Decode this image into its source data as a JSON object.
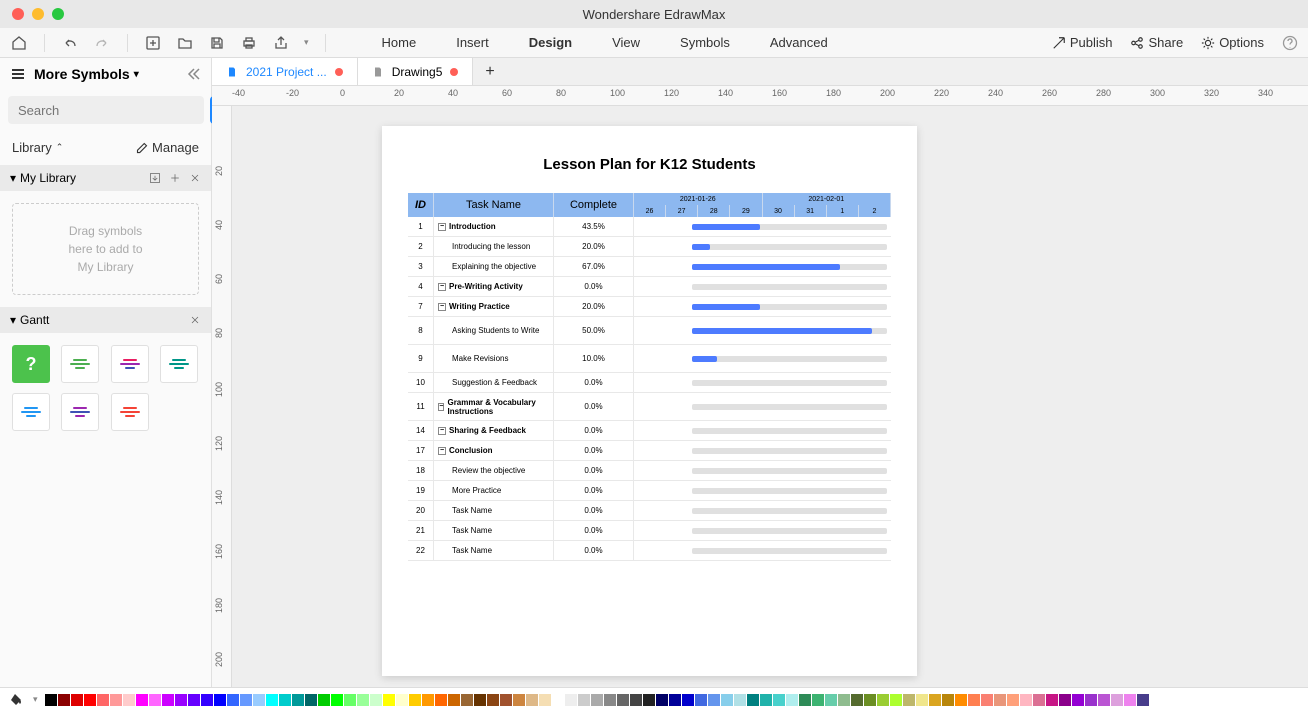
{
  "app_title": "Wondershare EdrawMax",
  "menu": [
    "Home",
    "Insert",
    "Design",
    "View",
    "Symbols",
    "Advanced"
  ],
  "menu_active": "Design",
  "right_actions": {
    "publish": "Publish",
    "share": "Share",
    "options": "Options"
  },
  "tabs": [
    {
      "label": "2021 Project ...",
      "modified": true,
      "active": true
    },
    {
      "label": "Drawing5",
      "modified": true,
      "active": false
    }
  ],
  "sidebar": {
    "title": "More Symbols",
    "search_placeholder": "Search",
    "search_btn": "Search",
    "library_label": "Library",
    "manage_label": "Manage",
    "mylibrary_label": "My Library",
    "dropzone": "Drag symbols\nhere to add to\nMy Library",
    "gantt_label": "Gantt"
  },
  "ruler_h": [
    "-40",
    "-20",
    "0",
    "20",
    "40",
    "60",
    "80",
    "100",
    "120",
    "140",
    "160",
    "180",
    "200",
    "220",
    "240",
    "260",
    "280",
    "300",
    "320",
    "340"
  ],
  "ruler_v": [
    "20",
    "40",
    "60",
    "80",
    "100",
    "120",
    "140",
    "160",
    "180",
    "200"
  ],
  "page": {
    "title": "Lesson Plan for K12 Students",
    "headers": {
      "id": "ID",
      "name": "Task Name",
      "complete": "Complete"
    },
    "weeks": [
      "2021-01-26",
      "2021-02-01"
    ],
    "days": [
      "26",
      "27",
      "28",
      "29",
      "30",
      "31",
      "1",
      "2"
    ],
    "rows": [
      {
        "id": "1",
        "name": "Introduction",
        "complete": "43.5%",
        "bold": true,
        "expand": true,
        "fill": 38
      },
      {
        "id": "2",
        "name": "Introducing the lesson",
        "complete": "20.0%",
        "indent": true,
        "fill": 10
      },
      {
        "id": "3",
        "name": "Explaining the objective",
        "complete": "67.0%",
        "indent": true,
        "fill": 82
      },
      {
        "id": "4",
        "name": "Pre-Writing Activity",
        "complete": "0.0%",
        "bold": true,
        "expand": true,
        "fill": 0
      },
      {
        "id": "7",
        "name": "Writing Practice",
        "complete": "20.0%",
        "bold": true,
        "expand": true,
        "fill": 38
      },
      {
        "id": "8",
        "name": "Asking Students to Write",
        "complete": "50.0%",
        "indent": true,
        "fill": 100,
        "tall": true
      },
      {
        "id": "9",
        "name": "Make Revisions",
        "complete": "10.0%",
        "indent": true,
        "fill": 14,
        "tall": true
      },
      {
        "id": "10",
        "name": "Suggestion & Feedback",
        "complete": "0.0%",
        "indent": true,
        "fill": 0
      },
      {
        "id": "11",
        "name": "Grammar & Vocabulary Instructions",
        "complete": "0.0%",
        "bold": true,
        "expand": true,
        "fill": 0,
        "tall": true
      },
      {
        "id": "14",
        "name": "Sharing & Feedback",
        "complete": "0.0%",
        "bold": true,
        "expand": true,
        "fill": 0
      },
      {
        "id": "17",
        "name": "Conclusion",
        "complete": "0.0%",
        "bold": true,
        "expand": true,
        "fill": 0
      },
      {
        "id": "18",
        "name": "Review the objective",
        "complete": "0.0%",
        "indent": true,
        "fill": 0
      },
      {
        "id": "19",
        "name": "More Practice",
        "complete": "0.0%",
        "indent": true,
        "fill": 0
      },
      {
        "id": "20",
        "name": "Task Name",
        "complete": "0.0%",
        "indent": true,
        "fill": 0
      },
      {
        "id": "21",
        "name": "Task Name",
        "complete": "0.0%",
        "indent": true,
        "fill": 0
      },
      {
        "id": "22",
        "name": "Task Name",
        "complete": "0.0%",
        "indent": true,
        "fill": 0
      }
    ]
  },
  "colors": [
    "#000",
    "#8b0000",
    "#d00",
    "#f00",
    "#f66",
    "#f99",
    "#fcc",
    "#f0f",
    "#f6f",
    "#c0f",
    "#90f",
    "#60f",
    "#30f",
    "#00f",
    "#36f",
    "#69f",
    "#9cf",
    "#0ff",
    "#0cc",
    "#099",
    "#066",
    "#0c0",
    "#0f0",
    "#6f6",
    "#9f9",
    "#cfc",
    "#ff0",
    "#ffc",
    "#fc0",
    "#f90",
    "#f60",
    "#c60",
    "#963",
    "#630",
    "#8b4513",
    "#a0522d",
    "#cd853f",
    "#deb887",
    "#f5deb3",
    "#fff",
    "#eee",
    "#ccc",
    "#aaa",
    "#888",
    "#666",
    "#444",
    "#222",
    "#006",
    "#009",
    "#00c",
    "#4169e1",
    "#6495ed",
    "#87ceeb",
    "#b0e0e6",
    "#008080",
    "#20b2aa",
    "#48d1cc",
    "#afeeee",
    "#2e8b57",
    "#3cb371",
    "#66cdaa",
    "#8fbc8f",
    "#556b2f",
    "#6b8e23",
    "#9acd32",
    "#adff2f",
    "#bdb76b",
    "#f0e68c",
    "#daa520",
    "#b8860b",
    "#ff8c00",
    "#ff7f50",
    "#fa8072",
    "#e9967a",
    "#ffa07a",
    "#ffb6c1",
    "#db7093",
    "#c71585",
    "#8b008b",
    "#9400d3",
    "#9932cc",
    "#ba55d3",
    "#dda0dd",
    "#ee82ee",
    "#483d8b"
  ]
}
